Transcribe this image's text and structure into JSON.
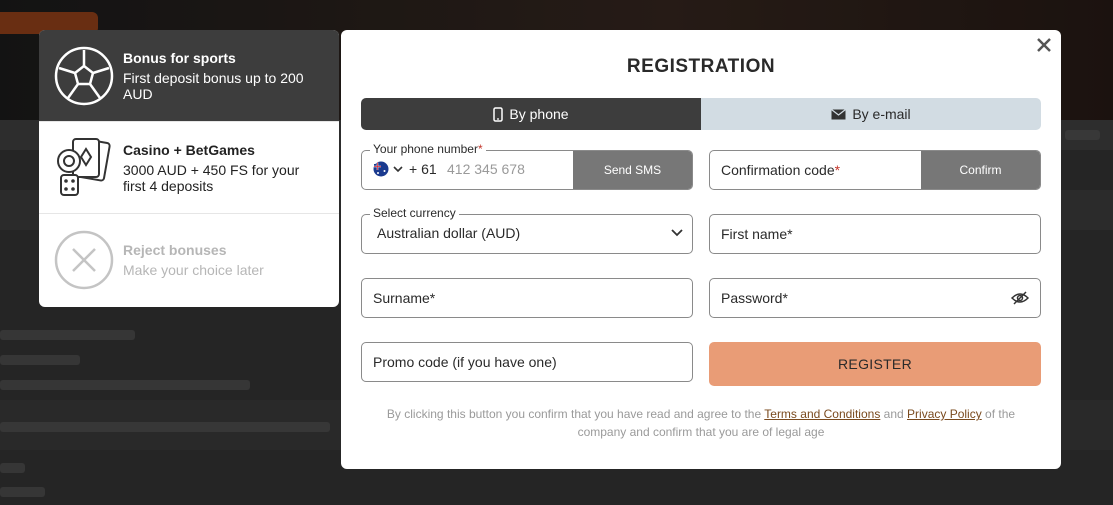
{
  "background": {
    "badge_color": "#a2481d"
  },
  "bonus_panel": {
    "items": [
      {
        "title": "Bonus for sports",
        "desc": "First deposit bonus up to 200 AUD",
        "icon": "soccer-ball-icon",
        "state": "selected"
      },
      {
        "title": "Casino + BetGames",
        "desc": "3000 AUD + 450 FS for your first 4 deposits",
        "icon": "casino-chips-cards-icon",
        "state": "default"
      },
      {
        "title": "Reject bonuses",
        "desc": "Make your choice later",
        "icon": "reject-icon",
        "state": "disabled"
      }
    ]
  },
  "modal": {
    "title": "REGISTRATION",
    "close_icon": "close-icon",
    "tabs": [
      {
        "label": "By phone",
        "icon": "phone-icon",
        "active": true
      },
      {
        "label": "By e-mail",
        "icon": "envelope-icon",
        "active": false
      }
    ],
    "phone": {
      "label": "Your phone number",
      "required_mark": "*",
      "flag": "australia-flag-icon",
      "prefix": "+ 61",
      "placeholder": "412 345 678",
      "send_button": "Send SMS"
    },
    "confirmation": {
      "placeholder": "Confirmation code",
      "required_mark": "*",
      "button": "Confirm"
    },
    "currency": {
      "label": "Select currency",
      "value": "Australian dollar (AUD)"
    },
    "first_name": {
      "placeholder": "First name*"
    },
    "surname": {
      "placeholder": "Surname*"
    },
    "password": {
      "placeholder": "Password*",
      "icon": "eye-hidden-icon"
    },
    "promo": {
      "placeholder": "Promo code (if you have one)"
    },
    "register_button": "REGISTER",
    "legal": {
      "before": "By clicking this button you confirm that you have read and agree to the ",
      "terms": "Terms and Conditions",
      "and": " and ",
      "privacy": "Privacy Policy",
      "after": " of the company and confirm that you are of legal age"
    }
  },
  "colors": {
    "accent_register": "#e99c76",
    "dark": "#3d3d3d",
    "tab_inactive": "#d2dce3",
    "required": "#c3362b",
    "link": "#7a4a1e"
  }
}
